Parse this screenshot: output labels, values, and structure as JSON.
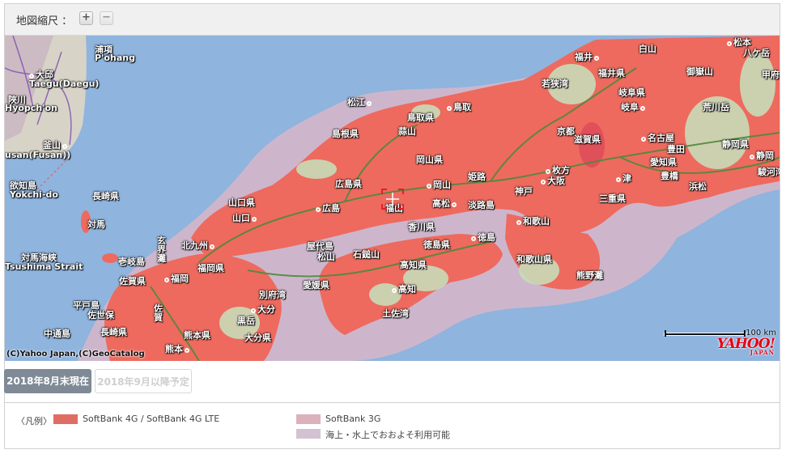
{
  "toolbar": {
    "zoom_label": "地図縮尺 ：",
    "zoom_in_glyph": "+",
    "zoom_out_glyph": "−"
  },
  "map": {
    "copyright": "(C)Yahoo Japan,(C)GeoCatalog",
    "scale_label": "100 km",
    "logo_text": "YAHOO!",
    "logo_sub": "JAPAN",
    "colors": {
      "sea": "#8fb4de",
      "lte": "#ee6a5e",
      "sea_coverage": "#cdb6cc",
      "land": "#c8dcb8"
    },
    "labels": [
      {
        "text": "松本",
        "city": true
      },
      {
        "text": "白山"
      },
      {
        "text": "八ケ岳"
      },
      {
        "text": "福井",
        "city": true
      },
      {
        "text": "御嶽山"
      },
      {
        "text": "福井県"
      },
      {
        "text": "岐阜県"
      },
      {
        "text": "甲府"
      },
      {
        "text": "若狭湾"
      },
      {
        "text": "荒川岳"
      },
      {
        "text": "岐阜",
        "city": true
      },
      {
        "text": "松江",
        "city": true
      },
      {
        "text": "鳥取",
        "city": true
      },
      {
        "text": "鳥取県"
      },
      {
        "text": "島根県"
      },
      {
        "text": "蒜山"
      },
      {
        "text": "京都",
        "city": true
      },
      {
        "text": "滋賀県"
      },
      {
        "text": "名古屋",
        "city": true
      },
      {
        "text": "豊田"
      },
      {
        "text": "静岡県"
      },
      {
        "text": "岡山県"
      },
      {
        "text": "静岡",
        "city": true
      },
      {
        "text": "広島県"
      },
      {
        "text": "姫路"
      },
      {
        "text": "枚方",
        "city": true
      },
      {
        "text": "愛知県"
      },
      {
        "text": "岡山",
        "city": true
      },
      {
        "text": "大阪",
        "city": true
      },
      {
        "text": "津",
        "city": true
      },
      {
        "text": "豊橋"
      },
      {
        "text": "浜松"
      },
      {
        "text": "駿河湾"
      },
      {
        "text": "神戸",
        "city": true
      },
      {
        "text": "山口県"
      },
      {
        "text": "広島",
        "city": true
      },
      {
        "text": "福山"
      },
      {
        "text": "高松",
        "city": true
      },
      {
        "text": "淡路島"
      },
      {
        "text": "三重県"
      },
      {
        "text": "山口",
        "city": true
      },
      {
        "text": "香川県"
      },
      {
        "text": "和歌山",
        "city": true
      },
      {
        "text": "徳島",
        "city": true
      },
      {
        "text": "北九州",
        "city": true
      },
      {
        "text": "屋代島"
      },
      {
        "text": "徳島県"
      },
      {
        "text": "松山",
        "city": true
      },
      {
        "text": "石鎚山"
      },
      {
        "text": "和歌山県"
      },
      {
        "text": "福岡県"
      },
      {
        "text": "高知県"
      },
      {
        "text": "熊野灘"
      },
      {
        "text": "福岡",
        "city": true
      },
      {
        "text": "愛媛県"
      },
      {
        "text": "佐賀県"
      },
      {
        "text": "高知",
        "city": true
      },
      {
        "text": "別府湾"
      },
      {
        "text": "大分",
        "city": true
      },
      {
        "text": "土佐湾"
      },
      {
        "text": "平戸島"
      },
      {
        "text": "佐世保"
      },
      {
        "text": "黒岳"
      },
      {
        "text": "長崎県"
      },
      {
        "text": "熊本県"
      },
      {
        "text": "大分県"
      },
      {
        "text": "中通島"
      },
      {
        "text": "熊本",
        "city": true
      },
      {
        "text": "浦項"
      },
      {
        "text": "P'ohang"
      },
      {
        "text": "大邱",
        "city": true
      },
      {
        "text": "Taegu(Daegu)"
      },
      {
        "text": "陜川"
      },
      {
        "text": "Hyopch'on"
      },
      {
        "text": "釜山",
        "city": true
      },
      {
        "text": "usan(Fusan))"
      },
      {
        "text": "欲知島"
      },
      {
        "text": "Yokchi-do"
      },
      {
        "text": "長崎県"
      },
      {
        "text": "対馬"
      },
      {
        "text": "対馬海峡"
      },
      {
        "text": "Tsushima Strait"
      },
      {
        "text": "壱岐島"
      },
      {
        "text": "玄界灘"
      },
      {
        "text": "佐賀"
      }
    ]
  },
  "tabs": {
    "current": "2018年8月末現在",
    "planned": "2018年9月以降予定"
  },
  "legend": {
    "title": "〈凡例〉",
    "items": [
      {
        "label": "SoftBank 4G / SoftBank 4G LTE",
        "color": "#e06d63"
      },
      {
        "label": "SoftBank 3G",
        "color": "#ddb0bd"
      },
      {
        "label": "海上・水上でおおよそ利用可能",
        "color": "#d3c2d2"
      }
    ]
  }
}
